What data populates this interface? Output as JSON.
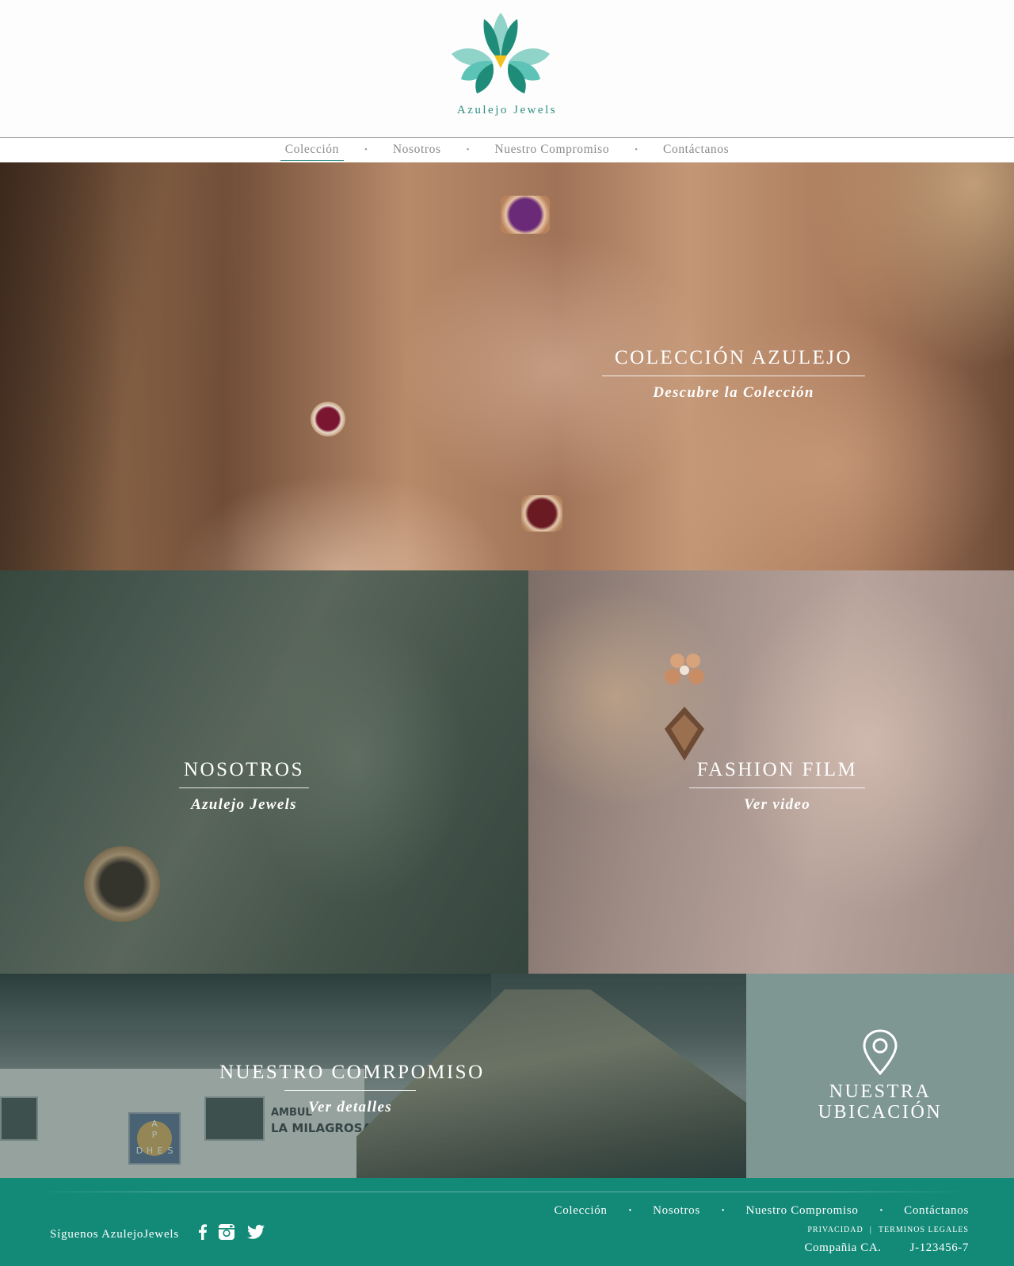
{
  "brand": {
    "name": "Azulejo Jewels"
  },
  "nav": {
    "items": [
      "Colección",
      "Nosotros",
      "Nuestro Compromiso",
      "Contáctanos"
    ],
    "active": "Colección",
    "separator": "•"
  },
  "hero": {
    "title": "COLECCIÓN AZULEJO",
    "subtitle": "Descubre la Colección"
  },
  "nosotros": {
    "title": "NOSOTROS",
    "subtitle": "Azulejo Jewels"
  },
  "fashion": {
    "title": "FASHION FILM",
    "subtitle": "Ver video"
  },
  "compromiso": {
    "title": "NUESTRO COMRPOMISO",
    "subtitle": "Ver detalles",
    "photo_signs": [
      "AMBUL",
      "LA MILAGROSA"
    ],
    "sign_letters": [
      "A",
      "P",
      "D",
      "H",
      "E",
      "S"
    ]
  },
  "ubicacion": {
    "title_line1": "NUESTRA",
    "title_line2": "UBICACIÓN",
    "icon": "map-pin-icon"
  },
  "footer": {
    "follow_text": "Síguenos AzulejoJewels",
    "social_icons": [
      "facebook-icon",
      "instagram-icon",
      "twitter-icon"
    ],
    "nav": [
      "Colección",
      "Nosotros",
      "Nuestro Compromiso",
      "Contáctanos"
    ],
    "separator": "•",
    "legal": [
      "PRIVACIDAD",
      "TERMINOS LEGALES"
    ],
    "legal_separator": "|",
    "company": "Compañia CA.",
    "rif": "J-123456-7"
  },
  "colors": {
    "brand_teal": "#2e8e82",
    "footer_bg": "#138a78",
    "location_bg": "#7e9792",
    "logo_dark": "#1f8c7a",
    "logo_light": "#5ec3b7",
    "logo_accent": "#f2c21b"
  }
}
